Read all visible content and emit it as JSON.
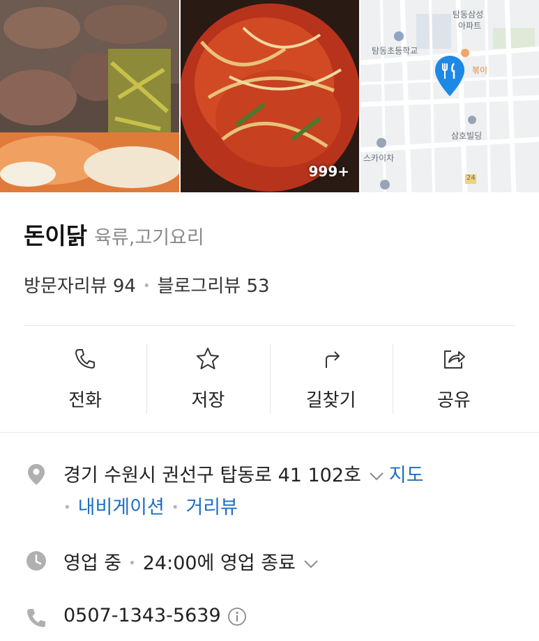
{
  "gallery": {
    "photo_count_badge": "999+",
    "map_labels": [
      "탐동삼성",
      "아파트",
      "탐동초등학교",
      "볶이",
      "삼호빌딩",
      "스카이차",
      "24"
    ]
  },
  "place": {
    "name": "돈이닭",
    "category": "육류,고기요리",
    "visitor_reviews": "방문자리뷰 94",
    "blog_reviews": "블로그리뷰 53"
  },
  "actions": [
    {
      "label": "전화",
      "icon": "phone-icon"
    },
    {
      "label": "저장",
      "icon": "star-icon"
    },
    {
      "label": "길찾기",
      "icon": "directions-icon"
    },
    {
      "label": "공유",
      "icon": "share-icon"
    }
  ],
  "address": {
    "text": "경기 수원시 권선구 탑동로 41 102호",
    "map_link": "지도",
    "navigation_link": "내비게이션",
    "street_view_link": "거리뷰"
  },
  "hours": {
    "status": "영업 중",
    "detail": "24:00에 영업 종료"
  },
  "phone": {
    "number": "0507-1343-5639"
  },
  "colors": {
    "link": "#1f6fc1",
    "marker": "#1e88e5",
    "icon_gray": "#b0b0b0"
  }
}
